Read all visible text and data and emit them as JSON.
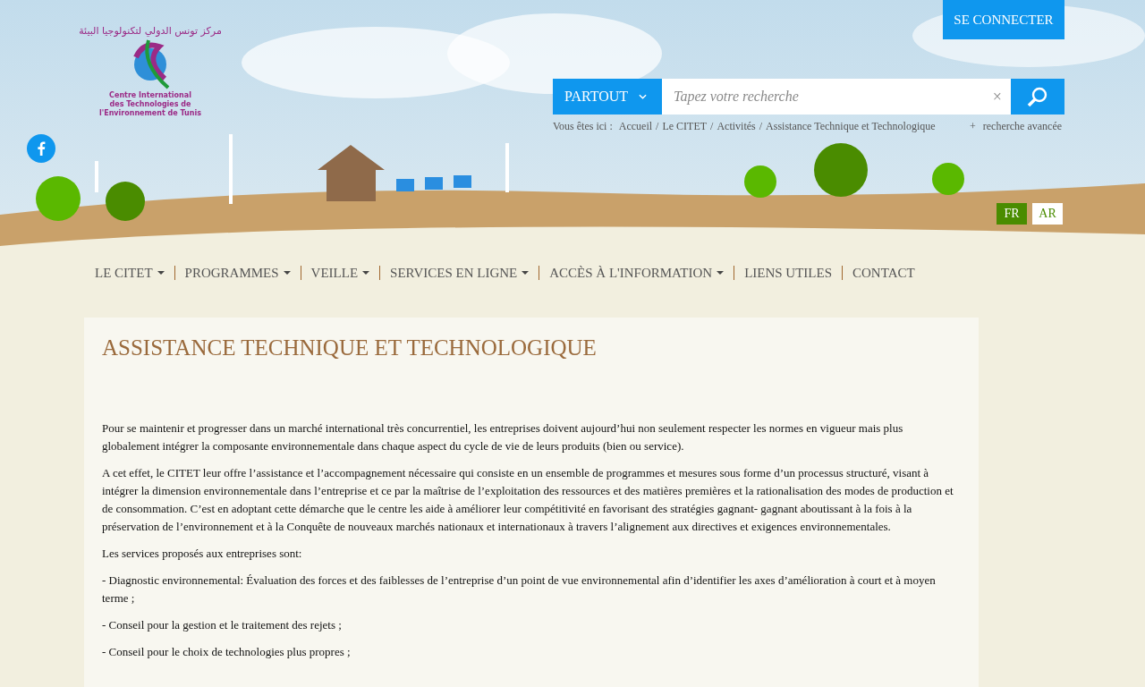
{
  "header": {
    "login_button": "SE CONNECTER",
    "logo": {
      "arabic": "مركز تونس الدولي لتكنولوجيا البيئة",
      "line_1": "Centre International",
      "line_2": "des Technologies de l'Environnement de Tunis"
    },
    "search": {
      "scope": "PARTOUT",
      "placeholder": "Tapez votre recherche",
      "clear": "×"
    },
    "breadcrumb": {
      "label": "Vous êtes ici :",
      "separator": "/",
      "items": [
        "Accueil",
        "Le CITET",
        "Activités",
        "Assistance Technique et Technologique"
      ]
    },
    "advanced_search": {
      "mark": "+",
      "label": "recherche avancée"
    },
    "languages": [
      {
        "label": "FR",
        "selected": true
      },
      {
        "label": "AR",
        "selected": false
      }
    ]
  },
  "nav": [
    {
      "label": "LE CITET",
      "dropdown": true
    },
    {
      "label": "PROGRAMMES",
      "dropdown": true
    },
    {
      "label": "VEILLE",
      "dropdown": true
    },
    {
      "label": "SERVICES EN LIGNE",
      "dropdown": true
    },
    {
      "label": "ACCÈS À L'INFORMATION",
      "dropdown": true
    },
    {
      "label": "LIENS UTILES",
      "dropdown": false
    },
    {
      "label": "CONTACT",
      "dropdown": false
    }
  ],
  "article": {
    "title": "ASSISTANCE TECHNIQUE ET TECHNOLOGIQUE",
    "paragraphs": [
      " Pour se maintenir et progresser dans un marché international très concurrentiel, les entreprises doivent aujourd’hui non seulement respecter les normes en vigueur mais plus globalement intégrer la composante environnementale dans chaque aspect du cycle de vie de leurs produits (bien ou service).",
      "A cet effet, le CITET leur offre l’assistance et l’accompagnement nécessaire qui consiste en un ensemble de programmes et mesures sous forme d’un processus structuré, visant à intégrer la dimension environnementale dans l’entreprise et ce par la maîtrise de l’exploitation des ressources et des matières premières et la rationalisation des modes de production et de consommation.  C’est en adoptant cette démarche que le centre les aide à améliorer leur compétitivité en favorisant des stratégies gagnant- gagnant aboutissant à la fois à la préservation de l’environnement et à la Conquête de nouveaux marchés nationaux et internationaux à travers l’alignement aux directives et exigences environnementales.",
      "Les services proposés aux entreprises sont:",
      "- Diagnostic environnemental: Évaluation des forces et des faiblesses de l’entreprise d’un point de vue environnemental afin d’identifier les axes d’amélioration à court et à moyen terme ;",
      "- Conseil pour la gestion et le traitement des rejets ;",
      "- Conseil pour le choix de technologies plus propres ;"
    ]
  }
}
